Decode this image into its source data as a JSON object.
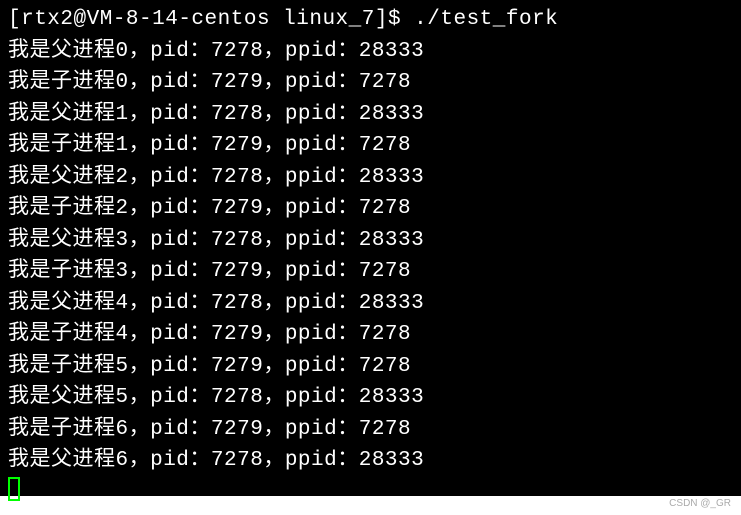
{
  "prompt": {
    "user": "rtx2",
    "host": "VM-8-14-centos",
    "dir": "linux_7",
    "symbol": "$",
    "command": "./test_fork",
    "full": "[rtx2@VM-8-14-centos linux_7]$ ./test_fork"
  },
  "lines": [
    "我是父进程0，pid：7278，ppid：28333",
    "我是子进程0，pid：7279，ppid：7278",
    "我是父进程1，pid：7278，ppid：28333",
    "我是子进程1，pid：7279，ppid：7278",
    "我是父进程2，pid：7278，ppid：28333",
    "我是子进程2，pid：7279，ppid：7278",
    "我是父进程3，pid：7278，ppid：28333",
    "我是子进程3，pid：7279，ppid：7278",
    "我是父进程4，pid：7278，ppid：28333",
    "我是子进程4，pid：7279，ppid：7278",
    "我是子进程5，pid：7279，ppid：7278",
    "我是父进程5，pid：7278，ppid：28333",
    "我是子进程6，pid：7279，ppid：7278",
    "我是父进程6，pid：7278，ppid：28333"
  ],
  "watermark": "CSDN @_GR"
}
